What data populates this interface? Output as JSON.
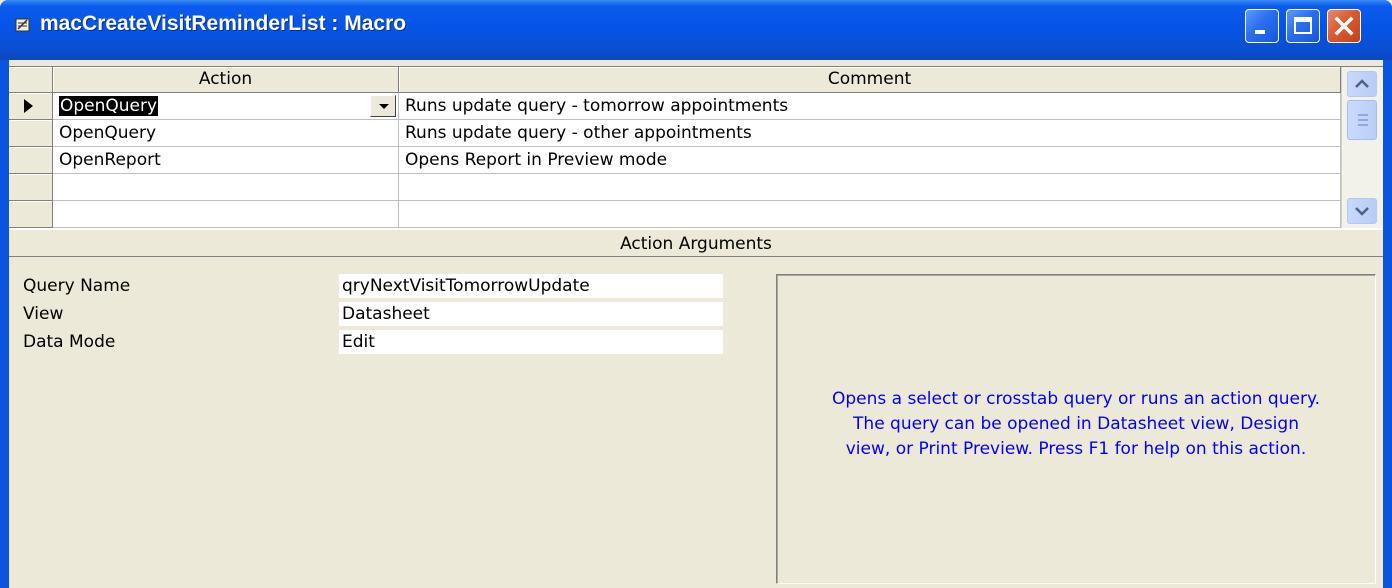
{
  "window": {
    "title": "macCreateVisitReminderList : Macro"
  },
  "grid": {
    "headers": {
      "action": "Action",
      "comment": "Comment"
    },
    "rows": [
      {
        "action": "OpenQuery",
        "comment": "Runs update query - tomorrow appointments",
        "current": true
      },
      {
        "action": "OpenQuery",
        "comment": "Runs update query - other appointments"
      },
      {
        "action": "OpenReport",
        "comment": "Opens Report in Preview mode"
      },
      {
        "action": "",
        "comment": ""
      },
      {
        "action": "",
        "comment": ""
      }
    ]
  },
  "arguments": {
    "title": "Action Arguments",
    "items": [
      {
        "label": "Query Name",
        "value": "qryNextVisitTomorrowUpdate"
      },
      {
        "label": "View",
        "value": "Datasheet"
      },
      {
        "label": "Data Mode",
        "value": "Edit"
      }
    ],
    "help_lines": [
      "Opens a select or crosstab query or runs an action query.",
      "The query can be opened in Datasheet view, Design",
      "view, or Print Preview. Press F1 for help on this action."
    ]
  },
  "colors": {
    "titlebar": "#0654e6",
    "help_text": "#0000ff",
    "face": "#ece9d8"
  },
  "icons": {
    "title": "macro-scroll-icon",
    "minimize": "minimize-icon",
    "maximize": "maximize-icon",
    "close": "close-icon"
  }
}
